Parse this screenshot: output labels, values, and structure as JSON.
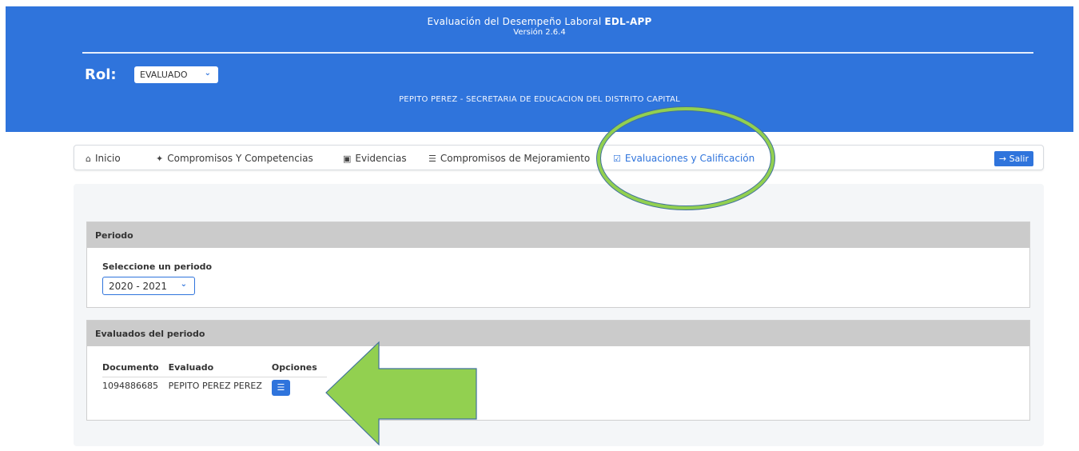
{
  "header": {
    "title_prefix": "Evaluación del Desempeño Laboral",
    "title_app": "EDL-APP",
    "version": "Versión 2.6.4",
    "rol_label": "Rol:",
    "rol_value": "EVALUADO",
    "user_line": "PEPITO PEREZ - SECRETARIA DE EDUCACION DEL DISTRITO CAPITAL",
    "color": "#2f74dc"
  },
  "nav": {
    "items": [
      {
        "label": "Inicio",
        "icon": "home-icon"
      },
      {
        "label": "Compromisos Y Competencias",
        "icon": "handshake-icon"
      },
      {
        "label": "Evidencias",
        "icon": "save-icon"
      },
      {
        "label": "Compromisos de Mejoramiento",
        "icon": "list-icon"
      },
      {
        "label": "Evaluaciones y Calificación",
        "icon": "clipboard-check-icon",
        "active": true
      }
    ],
    "logout_label": "Salir"
  },
  "periodo": {
    "heading": "Periodo",
    "select_label": "Seleccione un periodo",
    "selected": "2020 - 2021"
  },
  "evaluados": {
    "heading": "Evaluados del periodo",
    "columns": [
      "Documento",
      "Evaluado",
      "Opciones"
    ],
    "rows": [
      {
        "documento": "1094886685",
        "evaluado": "PEPITO PEREZ PEREZ"
      }
    ]
  },
  "annotations": {
    "color": "#92d050",
    "outline": "#41719c"
  }
}
